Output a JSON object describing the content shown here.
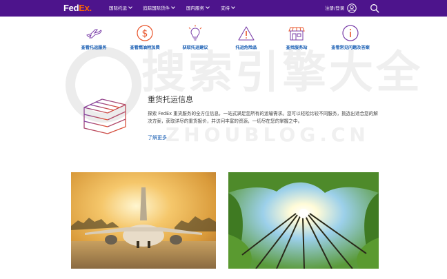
{
  "header": {
    "logo": {
      "part1": "Fed",
      "part2": "Ex."
    },
    "nav": [
      {
        "label": "国际托运"
      },
      {
        "label": "追踪国际货件"
      },
      {
        "label": "国内服务"
      },
      {
        "label": "支持"
      }
    ],
    "login_label": "注册/登录",
    "user_icon": "user-icon",
    "search_icon": "search-icon"
  },
  "services": [
    {
      "label": "查看托运服务",
      "icon": "airplane-icon"
    },
    {
      "label": "查看燃油附加费",
      "icon": "dollar-icon"
    },
    {
      "label": "获取托运建议",
      "icon": "lightbulb-icon"
    },
    {
      "label": "托运危险品",
      "icon": "warning-icon"
    },
    {
      "label": "查找服务站",
      "icon": "store-icon"
    },
    {
      "label": "查看常见问题及答案",
      "icon": "info-icon"
    }
  ],
  "watermark": {
    "main": "搜索引擎大全",
    "sub": "ZHOUBLOG.CN"
  },
  "freight": {
    "title": "重货托运信息",
    "description": "探索 FedEx 重货服务的全方位信息，一站式满足您所有的运输需求。您可以轻松比较不同服务，挑选出适合您的解决方案，获取详尽的重货报价，并访问丰富的资源，一切尽在您的掌握之中。",
    "learn_more": "了解更多",
    "icon": "cube-icon"
  },
  "images": [
    {
      "name": "airplane-photo"
    },
    {
      "name": "forest-photo"
    }
  ],
  "colors": {
    "brand_purple": "#4d148c",
    "brand_orange": "#ff6600",
    "link_blue": "#1a5fb4"
  }
}
